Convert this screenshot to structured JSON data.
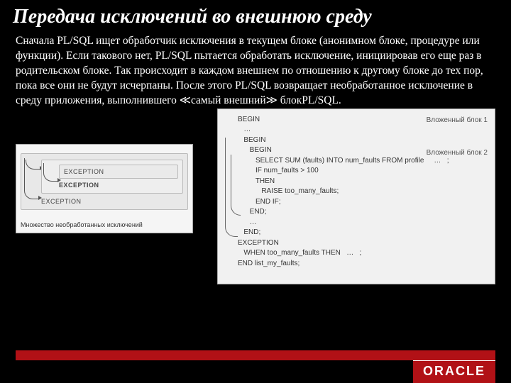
{
  "title": "Передача исключений во внешнюю среду",
  "body": "Сначала PL/SQL ищет обработчик исключения в текущем блоке (анонимном блоке, процедуре или функции). Если такового нет, PL/SQL пытается обработать исключение, инициировав его еще раз в родительском блоке. Так происходит в каждом внешнем по отношению к другому блоке до тех пор, пока все они не будут исчерпаны. После этого PL/SQL возвращает необработанное исключение в среду приложения, выполнившего ≪самый внешний≫ блокPL/SQL.",
  "left_diag": {
    "label": "EXCEPTION",
    "caption": "Множество необработанных исключений"
  },
  "right_diag": {
    "nest1": "Вложенный блок 1",
    "nest2": "Вложенный блок 2",
    "lines": {
      "l0": "BEGIN",
      "l1": "   …",
      "l2": "   BEGIN",
      "l3": "",
      "l4": "      BEGIN",
      "l5": "         SELECT SUM (faults) INTO num_faults FROM profile     …   ;",
      "l6": "         IF num_faults > 100",
      "l7": "         THEN",
      "l8": "            RAISE too_many_faults;",
      "l9": "         END IF;",
      "l10": "      END;",
      "l11": "      …",
      "l12": "   END;",
      "l13": "EXCEPTION",
      "l14": "   WHEN too_many_faults THEN   …   ;",
      "l15": "END list_my_faults;"
    }
  },
  "footer": {
    "logo": "ORACLE"
  }
}
